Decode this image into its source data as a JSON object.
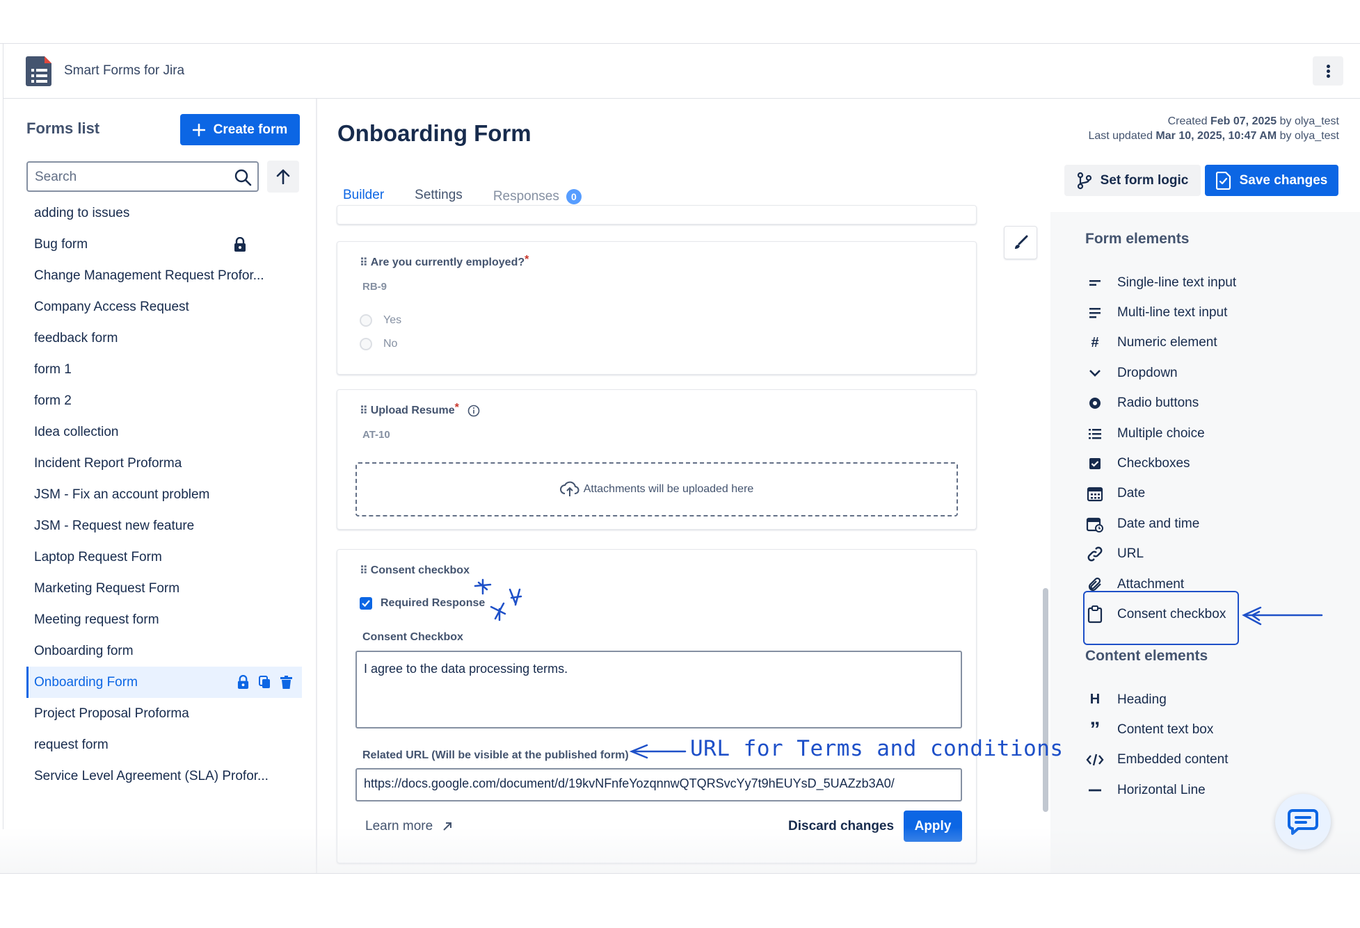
{
  "app": {
    "title": "Smart Forms for Jira"
  },
  "sidebar": {
    "title": "Forms list",
    "create_label": "Create form",
    "search_placeholder": "Search",
    "forms": [
      {
        "label": "adding to issues"
      },
      {
        "label": "Bug form",
        "locked": true
      },
      {
        "label": "Change Management Request Profor..."
      },
      {
        "label": "Company Access Request"
      },
      {
        "label": "feedback form"
      },
      {
        "label": "form 1"
      },
      {
        "label": "form 2"
      },
      {
        "label": "Idea collection"
      },
      {
        "label": "Incident Report Proforma"
      },
      {
        "label": "JSM - Fix an account problem"
      },
      {
        "label": "JSM - Request new feature"
      },
      {
        "label": "Laptop Request Form"
      },
      {
        "label": "Marketing Request Form"
      },
      {
        "label": "Meeting request form"
      },
      {
        "label": "Onboarding form"
      },
      {
        "label": "Onboarding Form",
        "active": true,
        "locked": true
      },
      {
        "label": "Project Proposal Proforma"
      },
      {
        "label": "request form"
      },
      {
        "label": "Service Level Agreement (SLA) Profor..."
      }
    ]
  },
  "main": {
    "title": "Onboarding Form",
    "meta": {
      "created_prefix": "Created",
      "created_date": "Feb 07, 2025",
      "created_by": "by olya_test",
      "updated_prefix": "Last updated",
      "updated_date": "Mar 10, 2025, 10:47 AM",
      "updated_by": "by olya_test"
    },
    "tabs": {
      "builder": "Builder",
      "settings": "Settings",
      "responses": "Responses",
      "responses_count": "0"
    },
    "actions": {
      "logic": "Set form logic",
      "save": "Save changes"
    },
    "questions": {
      "employed": {
        "label": "Are you currently employed?",
        "required_mark": "*",
        "code": "RB-9",
        "options": [
          "Yes",
          "No"
        ]
      },
      "resume": {
        "label": "Upload Resume",
        "required_mark": "*",
        "code": "AT-10",
        "dropzone": "Attachments will be uploaded here"
      },
      "consent": {
        "label": "Consent checkbox",
        "required_label": "Required Response",
        "field_label": "Consent Checkbox",
        "text_value": "I agree to the data processing terms.",
        "url_label": "Related URL (Will be visible at the published form)",
        "url_value": "https://docs.google.com/document/d/19kvNFnfeYozqnnwQTQRSvcYy7t9hEUYsD_5UAZzb3A0/",
        "learn_more": "Learn more",
        "discard": "Discard changes",
        "apply": "Apply"
      }
    }
  },
  "panel": {
    "form_title": "Form elements",
    "form_elements": [
      {
        "label": "Single-line text input",
        "icon": "single-line-icon"
      },
      {
        "label": "Multi-line text input",
        "icon": "multi-line-icon"
      },
      {
        "label": "Numeric element",
        "icon": "hash-icon"
      },
      {
        "label": "Dropdown",
        "icon": "chevron-down-icon"
      },
      {
        "label": "Radio buttons",
        "icon": "radio-icon"
      },
      {
        "label": "Multiple choice",
        "icon": "list-icon"
      },
      {
        "label": "Checkboxes",
        "icon": "checkbox-icon"
      },
      {
        "label": "Date",
        "icon": "calendar-icon"
      },
      {
        "label": "Date and time",
        "icon": "calendar-clock-icon"
      },
      {
        "label": "URL",
        "icon": "link-icon"
      },
      {
        "label": "Attachment",
        "icon": "paperclip-icon"
      },
      {
        "label": "Consent checkbox",
        "icon": "clipboard-icon"
      }
    ],
    "content_title": "Content elements",
    "content_elements": [
      {
        "label": "Heading",
        "icon": "heading-icon"
      },
      {
        "label": "Content text box",
        "icon": "quote-icon"
      },
      {
        "label": "Embedded content",
        "icon": "code-icon"
      },
      {
        "label": "Horizontal Line",
        "icon": "line-icon"
      }
    ]
  },
  "annotations": {
    "url_note": "URL for Terms and conditions"
  },
  "colors": {
    "primary": "#0c66e4",
    "annotation": "#1e50c8",
    "panel_bg": "#f7f8f9"
  }
}
